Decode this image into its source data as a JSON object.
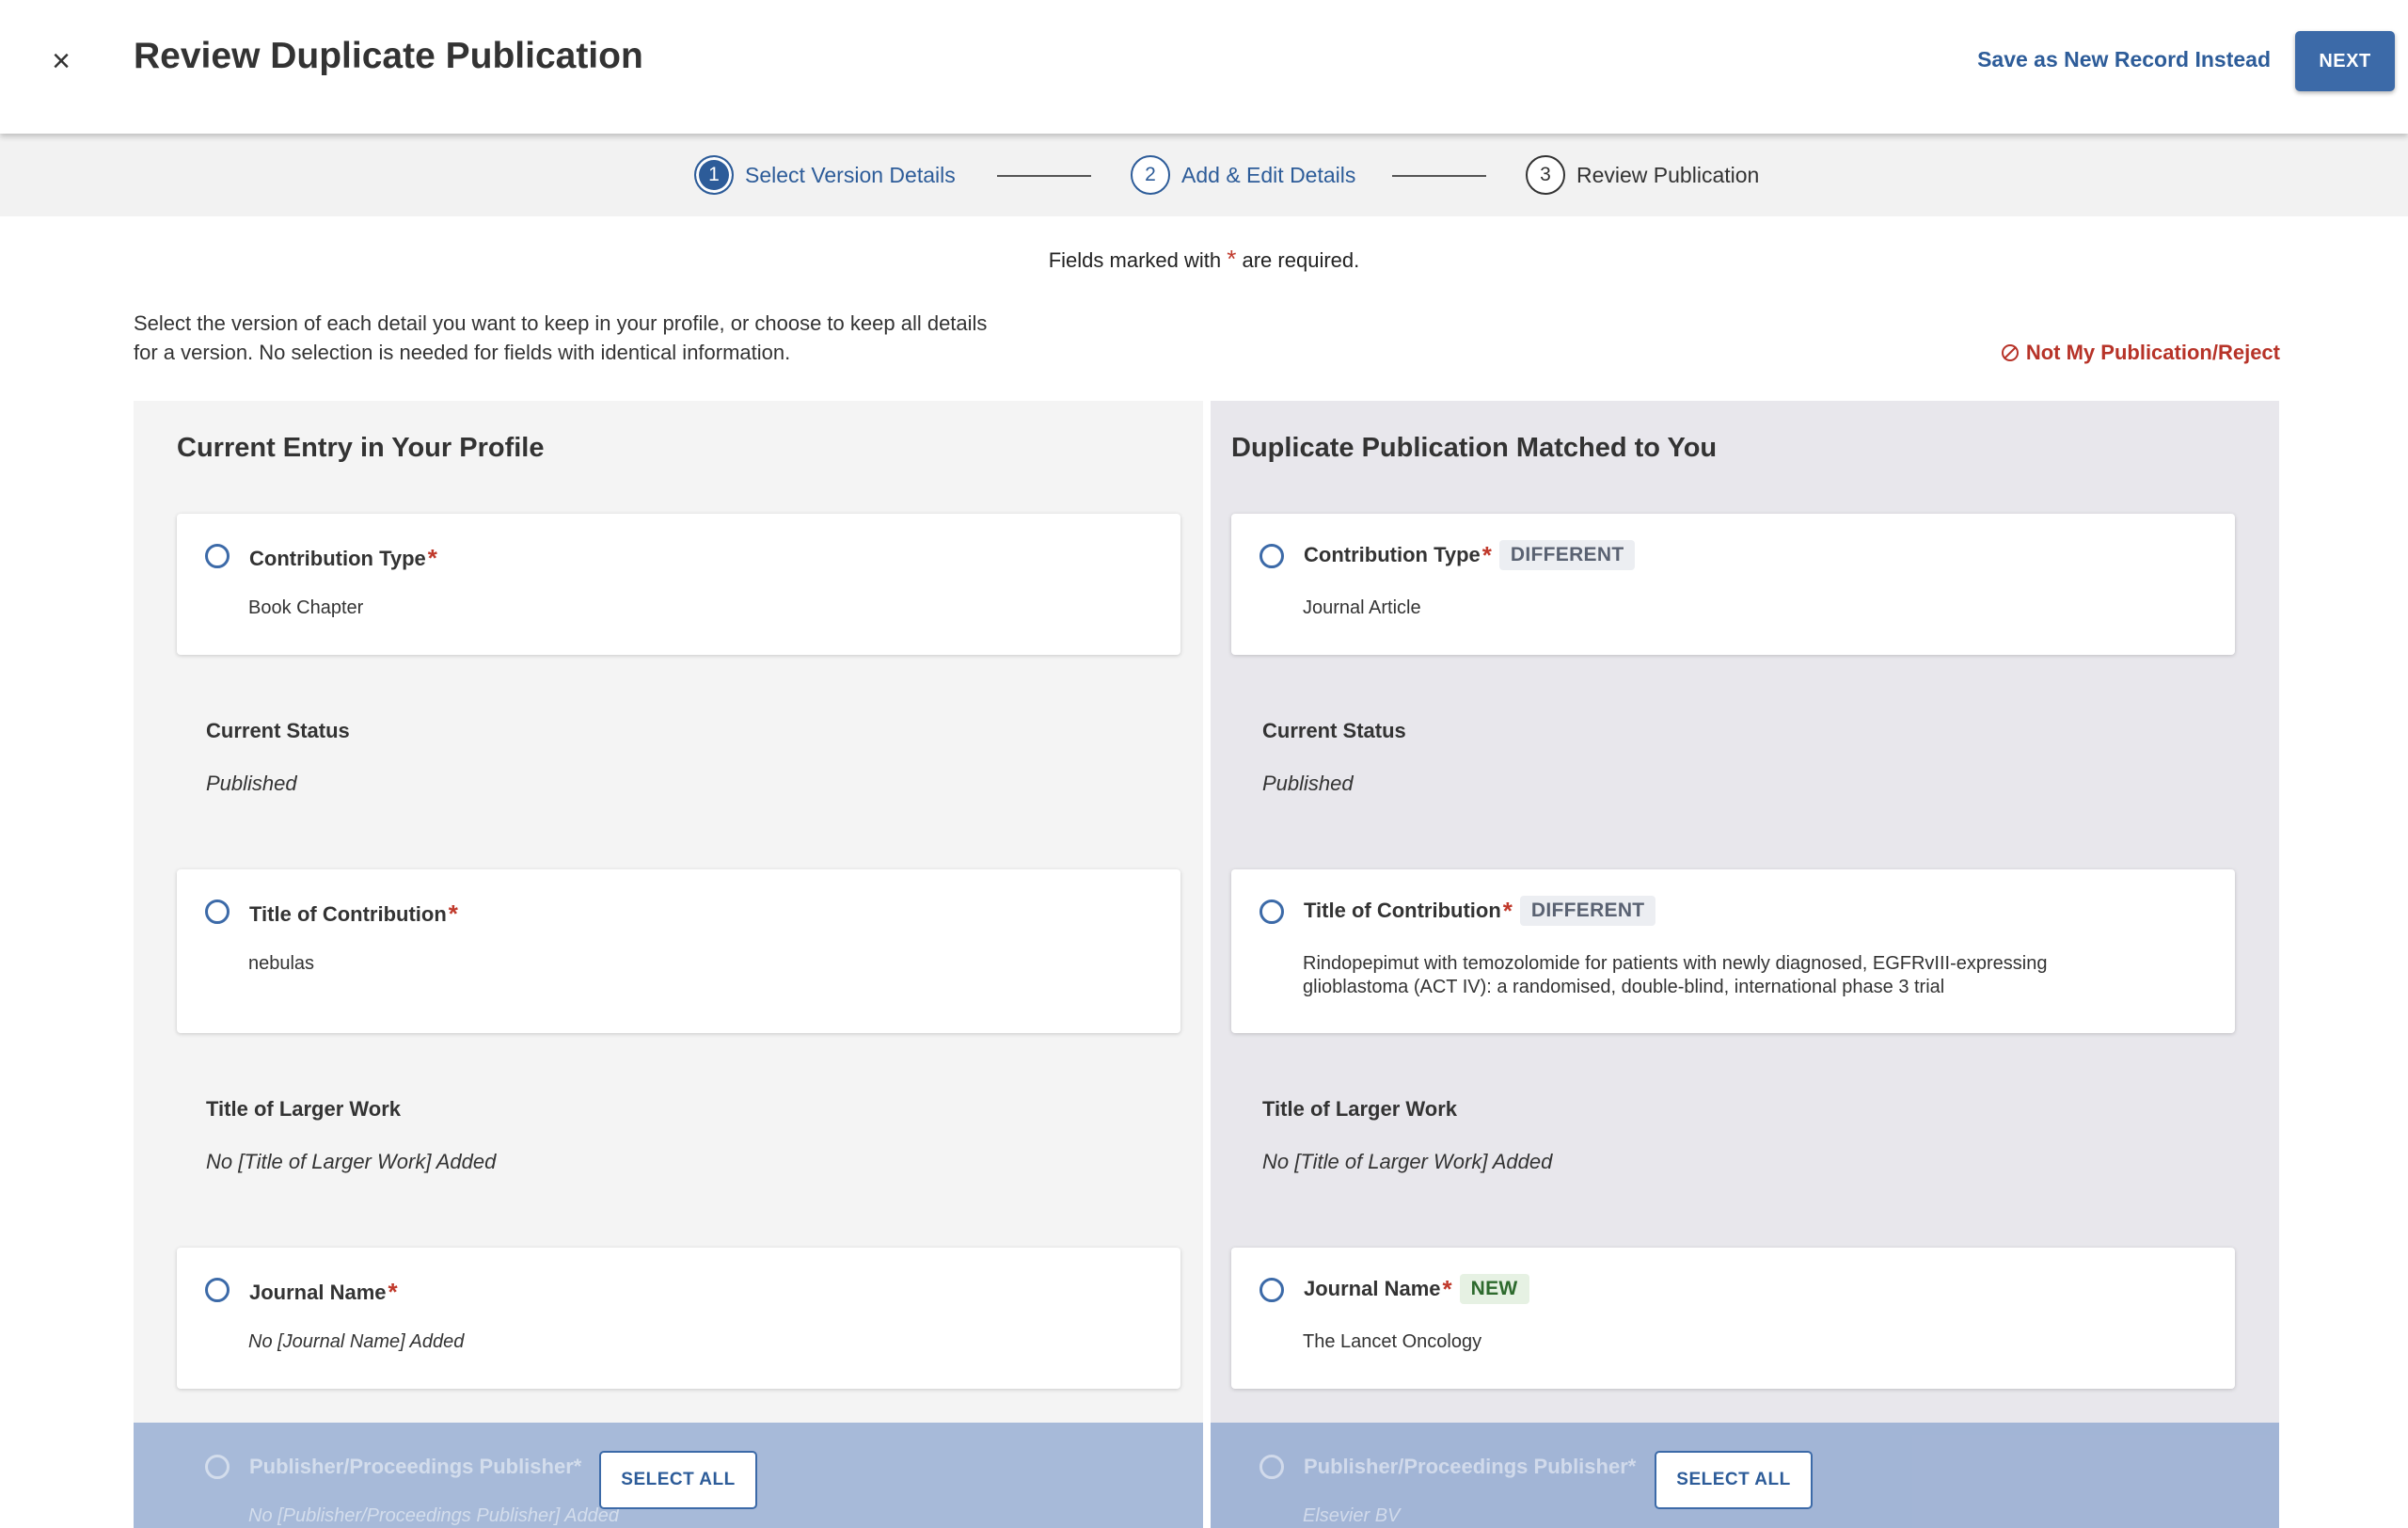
{
  "header": {
    "close_glyph": "×",
    "title": "Review Duplicate Publication",
    "save_new_label": "Save as New Record Instead",
    "next_label": "NEXT"
  },
  "stepper": {
    "steps": [
      {
        "number": "1",
        "label": "Select Version Details",
        "state": "active"
      },
      {
        "number": "2",
        "label": "Add & Edit Details",
        "state": "pending"
      },
      {
        "number": "3",
        "label": "Review Publication",
        "state": "future"
      }
    ]
  },
  "required_note": {
    "before": "Fields marked with",
    "star": "*",
    "after": "are required."
  },
  "instructions": "Select the version of each detail you want to keep in your profile, or choose to keep all details for a version. No selection is needed for fields with identical information.",
  "reject_label": "Not My Publication/Reject",
  "left": {
    "title": "Current Entry in Your Profile",
    "contribution_type": {
      "label": "Contribution Type",
      "value": "Book Chapter"
    },
    "current_status": {
      "label": "Current Status",
      "value": "Published"
    },
    "title_of_contribution": {
      "label": "Title of Contribution",
      "value": "nebulas"
    },
    "title_larger_work": {
      "label": "Title of Larger Work",
      "value": "No [Title of Larger Work] Added"
    },
    "journal_name": {
      "label": "Journal Name",
      "value": "No [Journal Name] Added"
    },
    "publisher": {
      "label": "Publisher/Proceedings Publisher",
      "value": "No [Publisher/Proceedings Publisher] Added"
    },
    "select_all_label": "SELECT ALL"
  },
  "right": {
    "title": "Duplicate Publication Matched to You",
    "contribution_type": {
      "label": "Contribution Type",
      "badge": "DIFFERENT",
      "value": "Journal Article"
    },
    "current_status": {
      "label": "Current Status",
      "value": "Published"
    },
    "title_of_contribution": {
      "label": "Title of Contribution",
      "badge": "DIFFERENT",
      "value": "Rindopepimut with temozolomide for patients with newly diagnosed, EGFRvIII-expressing glioblastoma (ACT IV): a randomised, double-blind, international phase 3 trial"
    },
    "title_larger_work": {
      "label": "Title of Larger Work",
      "value": "No [Title of Larger Work] Added"
    },
    "journal_name": {
      "label": "Journal Name",
      "badge": "NEW",
      "value": "The Lancet Oncology"
    },
    "publisher": {
      "label": "Publisher/Proceedings Publisher",
      "value": "Elsevier BV"
    },
    "select_all_label": "SELECT ALL"
  },
  "colors": {
    "primary": "#3c6aa8",
    "link": "#2d5c99",
    "danger": "#b73328",
    "required": "#c0392b"
  }
}
